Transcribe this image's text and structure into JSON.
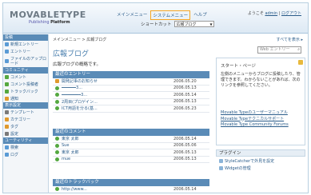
{
  "header": {
    "logo_main": "MOVABLETYPE",
    "logo_sub_prefix": "Publishing ",
    "logo_sub_bold": "Platform",
    "nav": [
      "メインメニュー",
      "システムメニュー",
      "ヘルプ"
    ],
    "user_prefix": "ようこそ",
    "user_name": "admin",
    "user_sep": "|",
    "logout": "ログアウト",
    "shortcut_label": "ショートカット",
    "shortcut_value": "広報ブログ"
  },
  "sidebar": [
    {
      "type": "section",
      "label": "投稿"
    },
    {
      "type": "item",
      "label": "新規エントリー",
      "icon": "new-entry-icon",
      "color": "#5a9bd5"
    },
    {
      "type": "item",
      "label": "エントリー",
      "icon": "entry-icon",
      "color": "#5a9bd5"
    },
    {
      "type": "item",
      "label": "ファイルのアップロード",
      "icon": "upload-icon",
      "color": "#5a9bd5"
    },
    {
      "type": "section",
      "label": "コミュニティ"
    },
    {
      "type": "item",
      "label": "コメント",
      "icon": "comment-icon",
      "color": "#55a840"
    },
    {
      "type": "item",
      "label": "コメント投稿者",
      "icon": "commenter-icon",
      "color": "#55a840"
    },
    {
      "type": "item",
      "label": "トラックバック",
      "icon": "trackback-icon",
      "color": "#55a840"
    },
    {
      "type": "item",
      "label": "通知",
      "icon": "notification-icon",
      "color": "#e09a2d"
    },
    {
      "type": "section",
      "label": "表示設定"
    },
    {
      "type": "item",
      "label": "テンプレート",
      "icon": "template-icon",
      "color": "#7a7a7a"
    },
    {
      "type": "item",
      "label": "カテゴリー",
      "icon": "category-icon",
      "color": "#e09a2d"
    },
    {
      "type": "item",
      "label": "タグ",
      "icon": "tag-icon",
      "color": "#e09a2d"
    },
    {
      "type": "item",
      "label": "設定",
      "icon": "settings-icon",
      "color": "#7a7a7a"
    },
    {
      "type": "section",
      "label": "ユーティリティ"
    },
    {
      "type": "item",
      "label": "検索",
      "icon": "search-icon",
      "color": "#5a9bd5"
    },
    {
      "type": "item",
      "label": "ログ",
      "icon": "log-icon",
      "color": "#5a9bd5"
    }
  ],
  "main": {
    "breadcrumb": "メインメニュー > 広報ブログ",
    "help_link": "すべてを表示 ▸",
    "title": "広報ブログ",
    "search_placeholder": "Web エントリー",
    "description": "広報ブログの概略です。",
    "entries_header": "最近のエントリー",
    "entries": [
      {
        "title": "開発記事のお知らせ",
        "date": "2006.05.20",
        "icon": "pencil"
      },
      {
        "title": "━━━━━━3...",
        "date": "2006.05.13",
        "icon": "dot"
      },
      {
        "title": "━━━━━━━━3...",
        "date": "2006.05.14",
        "icon": "dot"
      },
      {
        "title": "2周目(プロゲイン...",
        "date": "2006.05.13",
        "icon": "dot"
      },
      {
        "title": "ICT用語を分る(基...",
        "date": "2006.05.23",
        "icon": "dot"
      }
    ],
    "comments_header": "最近のコメント",
    "comments": [
      {
        "title": "東京 太郎",
        "date": "2006.05.14"
      },
      {
        "title": "Sue",
        "date": "2006.05.06"
      },
      {
        "title": "東京 太郎",
        "date": "2006.05.13"
      },
      {
        "title": "mue",
        "date": "2006.05.13"
      }
    ],
    "trackbacks_header": "最近のトラックバック",
    "trackbacks": [
      {
        "title": "http://www...",
        "date": "2006.05.14"
      }
    ]
  },
  "start": {
    "title": "スタート・ページ",
    "text": "左側のメニューからブログに投稿したり、管理できます。わからないことがあれば、次のリンクを参照してください。",
    "links": [
      "Movable Typeのユーザーマニュアル",
      "Movable Typeテクニカルサポート",
      "Movable Type Community Forums"
    ]
  },
  "plugins": {
    "header": "プラグイン",
    "items": [
      "StyleCatcherで外見を設定",
      "Widgetの管理"
    ]
  }
}
